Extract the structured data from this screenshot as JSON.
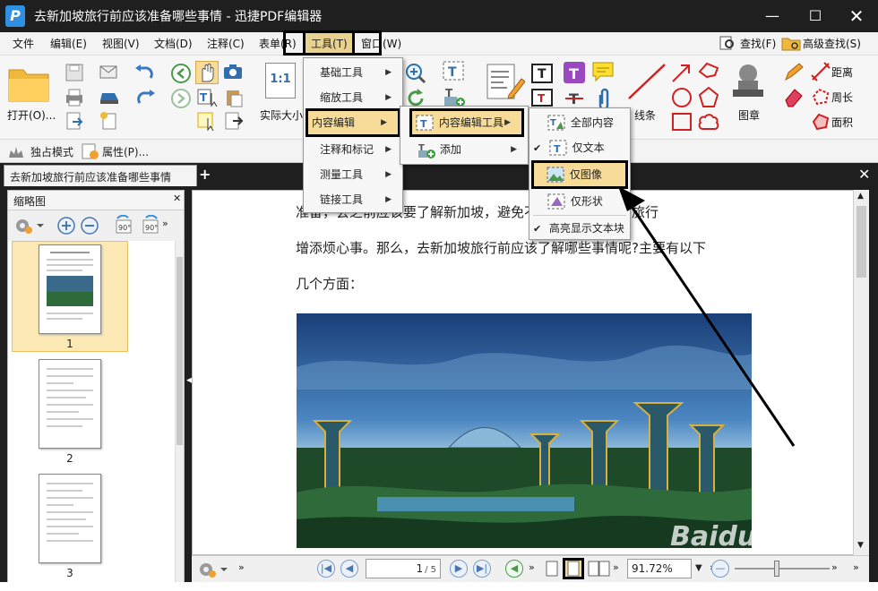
{
  "window": {
    "title": "去新加坡旅行前应该准备哪些事情 - 迅捷PDF编辑器",
    "logo": "P"
  },
  "menubar": {
    "items": [
      "文件",
      "编辑(E)",
      "视图(V)",
      "文档(D)",
      "注释(C)",
      "表单(R)",
      "工具(T)",
      "窗口(W)"
    ],
    "find": "查找(F)",
    "advanced_find": "高级查找(S)"
  },
  "ribbon": {
    "open_label": "打开(O)...",
    "actual_size_label": "实际大小",
    "actual_size_icon_text": "1:1",
    "line_label": "线条",
    "stamp_label": "图章",
    "distance_label": "距离",
    "perimeter_label": "周长",
    "area_label": "面积"
  },
  "modebar": {
    "exclusive_mode": "独占模式",
    "properties": "属性(P)..."
  },
  "tab": {
    "title": "去新加坡旅行前应该准备哪些事情"
  },
  "sidebar": {
    "title": "缩略图",
    "page_numbers": [
      "1",
      "2",
      "3"
    ]
  },
  "document": {
    "lines": [
      "准备，会之前应该要了解新加坡，避免不必要的问题，为旅行",
      "增添烦心事。那么，去新加坡旅行前应该了解哪些事情呢?主要有以下",
      "几个方面："
    ]
  },
  "tools_menu": {
    "items": [
      "基础工具",
      "缩放工具",
      "内容编辑",
      "注释和标记",
      "测量工具",
      "链接工具"
    ]
  },
  "content_edit_menu": {
    "items": [
      "内容编辑工具",
      "添加"
    ]
  },
  "content_edit_tools_menu": {
    "items": [
      "全部内容",
      "仅文本",
      "仅图像",
      "仅形状",
      "高亮显示文本块"
    ]
  },
  "statusbar": {
    "page_value": "1",
    "page_total": "/ 5",
    "zoom": "91.72%"
  },
  "watermark": "Baidu经验",
  "colors": {
    "titlebar": "#1f1f1f",
    "menu_highlight": "#e9d18f",
    "menu_selected": "#f6dc98",
    "accent_blue": "#2f8fe0"
  }
}
